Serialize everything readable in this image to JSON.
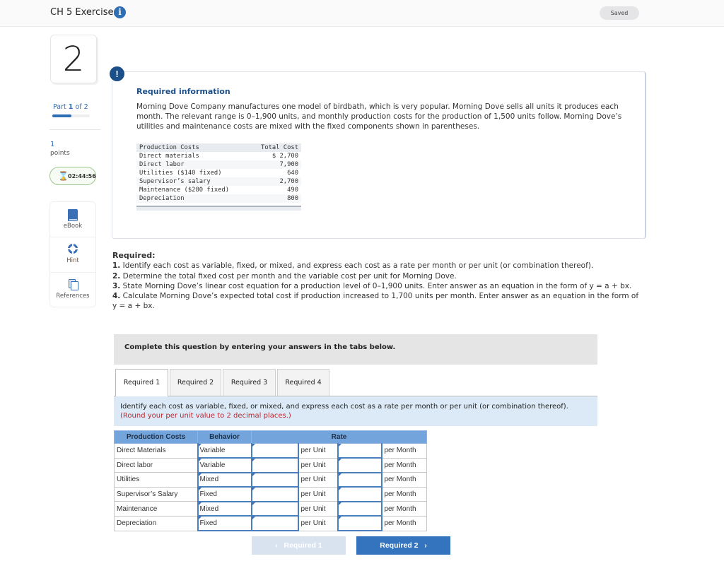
{
  "header": {
    "title": "CH 5 Exercises",
    "info_icon": "info-icon",
    "status": "Saved"
  },
  "sidebar": {
    "question_number": "2",
    "part_prefix": "Part",
    "part_current": "1",
    "part_suffix": "of 2",
    "part_progress": 0.5,
    "points_value": "1",
    "points_label": "points",
    "timer_icon": "hourglass-icon",
    "timer": "02:44:56",
    "tools": [
      {
        "label": "eBook",
        "icon": "book-icon"
      },
      {
        "label": "Hint",
        "icon": "lifebuoy-icon"
      },
      {
        "label": "References",
        "icon": "documents-icon"
      }
    ]
  },
  "required_info": {
    "alert_icon": "!",
    "title": "Required information",
    "text": "Morning Dove Company manufactures one model of birdbath, which is very popular. Morning Dove sells all units it produces each month. The relevant range is 0–1,900 units, and monthly production costs for the production of 1,500 units follow. Morning Dove’s utilities and maintenance costs are mixed with the fixed components shown in parentheses.",
    "cost_table": {
      "headers": [
        "Production Costs",
        "Total Cost"
      ],
      "rows": [
        [
          "Direct materials",
          "$ 2,700"
        ],
        [
          "Direct labor",
          "7,900"
        ],
        [
          "Utilities ($140 fixed)",
          "640"
        ],
        [
          "Supervisor’s salary",
          "2,700"
        ],
        [
          "Maintenance ($280 fixed)",
          "490"
        ],
        [
          "Depreciation",
          "800"
        ]
      ]
    }
  },
  "required": {
    "heading": "Required:",
    "items": [
      {
        "num": "1.",
        "text": " Identify each cost as variable, fixed, or mixed, and express each cost as a rate per month or per unit (or combination thereof)."
      },
      {
        "num": "2.",
        "text": " Determine the total fixed cost per month and the variable cost per unit for Morning Dove."
      },
      {
        "num": "3.",
        "text": " State Morning Dove’s linear cost equation for a production level of 0–1,900 units. Enter answer as an equation in the form of y = a + bx."
      },
      {
        "num": "4.",
        "text": " Calculate Morning Dove’s expected total cost if production increased to 1,700 units per month. Enter answer as an equation in the form of y = a + bx."
      }
    ]
  },
  "complete_banner": "Complete this question by entering your answers in the tabs below.",
  "tabs": [
    {
      "label": "Required 1",
      "active": true
    },
    {
      "label": "Required 2",
      "active": false
    },
    {
      "label": "Required 3",
      "active": false
    },
    {
      "label": "Required 4",
      "active": false
    }
  ],
  "instructions": {
    "text": "Identify each cost as variable, fixed, or mixed, and express each cost as a rate per month or per unit (or combination thereof). ",
    "note": "(Round your per unit value to 2 decimal places.)"
  },
  "answer_table": {
    "headers": {
      "costs": "Production Costs",
      "behavior": "Behavior",
      "rate": "Rate"
    },
    "unit_label": "per Unit",
    "month_label": "per Month",
    "rows": [
      {
        "cost": "Direct Materials",
        "behavior": "Variable",
        "per_unit": "",
        "per_month": ""
      },
      {
        "cost": "Direct labor",
        "behavior": "Variable",
        "per_unit": "",
        "per_month": ""
      },
      {
        "cost": "Utilities",
        "behavior": "Mixed",
        "per_unit": "",
        "per_month": ""
      },
      {
        "cost": "Supervisor’s Salary",
        "behavior": "Fixed",
        "per_unit": "",
        "per_month": ""
      },
      {
        "cost": "Maintenance",
        "behavior": "Mixed",
        "per_unit": "",
        "per_month": ""
      },
      {
        "cost": "Depreciation",
        "behavior": "Fixed",
        "per_unit": "",
        "per_month": ""
      }
    ]
  },
  "navigation": {
    "prev_label": "Required 1",
    "next_label": "Required 2",
    "prev_chevron": "‹",
    "next_chevron": "›"
  },
  "colors": {
    "accent": "#2f6db5",
    "header_blue": "#73a5dc",
    "instruction_bg": "#dceaf7",
    "note_red": "#c0262d",
    "next_button": "#3473bd",
    "timer_green": "#3d7a37"
  }
}
